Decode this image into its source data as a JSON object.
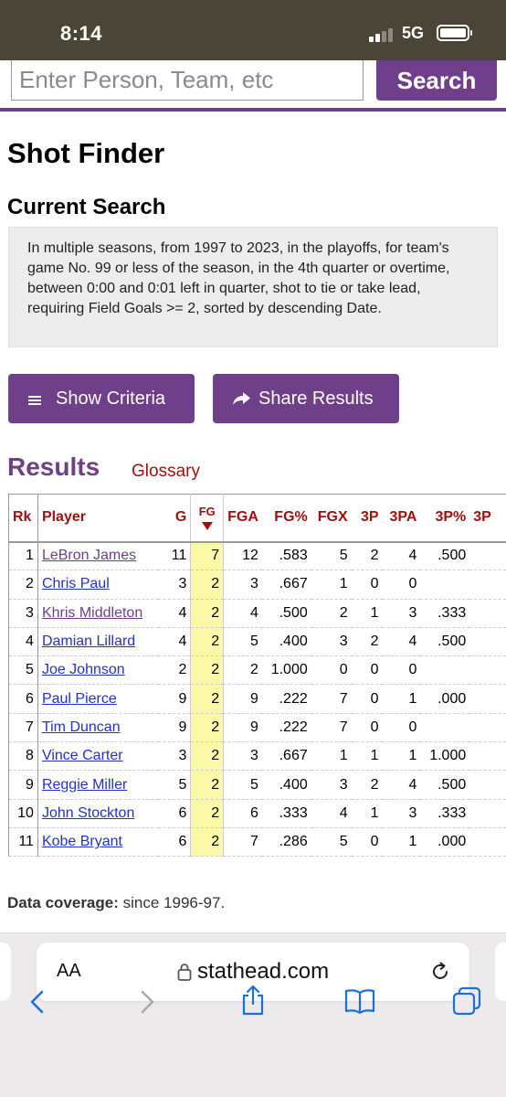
{
  "status_bar": {
    "time": "8:14",
    "network": "5G"
  },
  "search": {
    "placeholder": "Enter Person, Team, etc",
    "button_label": "Search"
  },
  "page_title": "Shot Finder",
  "current_search": {
    "heading": "Current Search",
    "description": "In multiple seasons, from 1997 to 2023, in the playoffs, for team's game No. 99 or less of the season, in the 4th quarter or overtime, between 0:00 and 0:01 left in quarter, shot to tie or take lead, requiring Field Goals >= 2, sorted by descending Date."
  },
  "buttons": {
    "show_criteria": "Show Criteria",
    "share_results": "Share Results"
  },
  "results": {
    "heading": "Results",
    "glossary_label": "Glossary",
    "columns": [
      "Rk",
      "Player",
      "G",
      "FG",
      "FGA",
      "FG%",
      "FGX",
      "3P",
      "3PA",
      "3P%",
      "3P"
    ],
    "rows": [
      {
        "rk": "1",
        "player": "LeBron James",
        "g": "11",
        "fg": "7",
        "fga": "12",
        "fg_pct": ".583",
        "fgx": "5",
        "tp": "2",
        "tpa": "4",
        "tp_pct": ".500",
        "visited": true
      },
      {
        "rk": "2",
        "player": "Chris Paul",
        "g": "3",
        "fg": "2",
        "fga": "3",
        "fg_pct": ".667",
        "fgx": "1",
        "tp": "0",
        "tpa": "0",
        "tp_pct": "",
        "visited": false
      },
      {
        "rk": "3",
        "player": "Khris Middleton",
        "g": "4",
        "fg": "2",
        "fga": "4",
        "fg_pct": ".500",
        "fgx": "2",
        "tp": "1",
        "tpa": "3",
        "tp_pct": ".333",
        "visited": true
      },
      {
        "rk": "4",
        "player": "Damian Lillard",
        "g": "4",
        "fg": "2",
        "fga": "5",
        "fg_pct": ".400",
        "fgx": "3",
        "tp": "2",
        "tpa": "4",
        "tp_pct": ".500",
        "visited": false
      },
      {
        "rk": "5",
        "player": "Joe Johnson",
        "g": "2",
        "fg": "2",
        "fga": "2",
        "fg_pct": "1.000",
        "fgx": "0",
        "tp": "0",
        "tpa": "0",
        "tp_pct": "",
        "visited": false
      },
      {
        "rk": "6",
        "player": "Paul Pierce",
        "g": "9",
        "fg": "2",
        "fga": "9",
        "fg_pct": ".222",
        "fgx": "7",
        "tp": "0",
        "tpa": "1",
        "tp_pct": ".000",
        "visited": false
      },
      {
        "rk": "7",
        "player": "Tim Duncan",
        "g": "9",
        "fg": "2",
        "fga": "9",
        "fg_pct": ".222",
        "fgx": "7",
        "tp": "0",
        "tpa": "0",
        "tp_pct": "",
        "visited": false
      },
      {
        "rk": "8",
        "player": "Vince Carter",
        "g": "3",
        "fg": "2",
        "fga": "3",
        "fg_pct": ".667",
        "fgx": "1",
        "tp": "1",
        "tpa": "1",
        "tp_pct": "1.000",
        "visited": false
      },
      {
        "rk": "9",
        "player": "Reggie Miller",
        "g": "5",
        "fg": "2",
        "fga": "5",
        "fg_pct": ".400",
        "fgx": "3",
        "tp": "2",
        "tpa": "4",
        "tp_pct": ".500",
        "visited": false
      },
      {
        "rk": "10",
        "player": "John Stockton",
        "g": "6",
        "fg": "2",
        "fga": "6",
        "fg_pct": ".333",
        "fgx": "4",
        "tp": "1",
        "tpa": "3",
        "tp_pct": ".333",
        "visited": false
      },
      {
        "rk": "11",
        "player": "Kobe Bryant",
        "g": "6",
        "fg": "2",
        "fga": "7",
        "fg_pct": ".286",
        "fgx": "5",
        "tp": "0",
        "tpa": "1",
        "tp_pct": ".000",
        "visited": false
      }
    ]
  },
  "coverage": {
    "label": "Data coverage:",
    "value": "since 1996-97."
  },
  "browser": {
    "aa_label": "AA",
    "domain": "stathead.com"
  },
  "colors": {
    "brand_purple": "#6f3f8a",
    "header_red": "#a01010",
    "link_blue": "#2232c9",
    "highlight_yellow": "#fbf8a8"
  }
}
